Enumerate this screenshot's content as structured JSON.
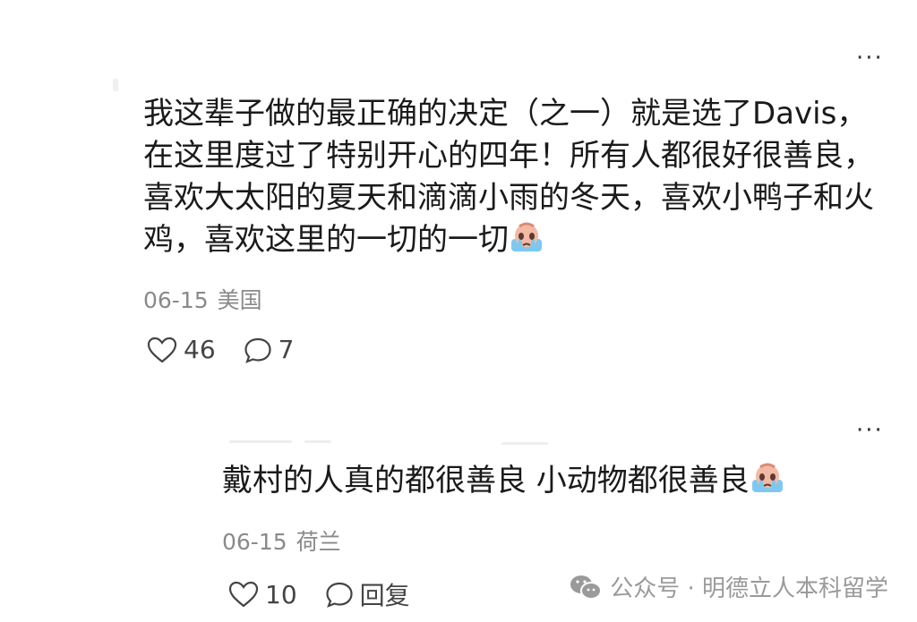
{
  "comments": [
    {
      "lines": [
        "我这辈子做的最正确的决定（之一）就是选了Davis，",
        "在这里度过了特别开心的四年！所有人都很好很善良，",
        "喜欢大太阳的夏天和滴滴小雨的冬天，喜欢小鸭子和火",
        "鸡，喜欢这里的一切的一切"
      ],
      "emoji": "crying-face",
      "date": "06-15",
      "location": "美国",
      "likes": "46",
      "replies": "7",
      "more": "···"
    },
    {
      "lines": [
        "戴村的人真的都很善良 小动物都很善良"
      ],
      "emoji": "crying-face",
      "date": "06-15",
      "location": "荷兰",
      "likes": "10",
      "reply_label": "回复",
      "more": "···"
    }
  ],
  "watermark": {
    "icon": "wechat-icon",
    "text": "公众号 · 明德立人本科留学"
  },
  "colors": {
    "text": "#1a1a1a",
    "meta": "#8a8a8a",
    "icon": "#444444"
  }
}
